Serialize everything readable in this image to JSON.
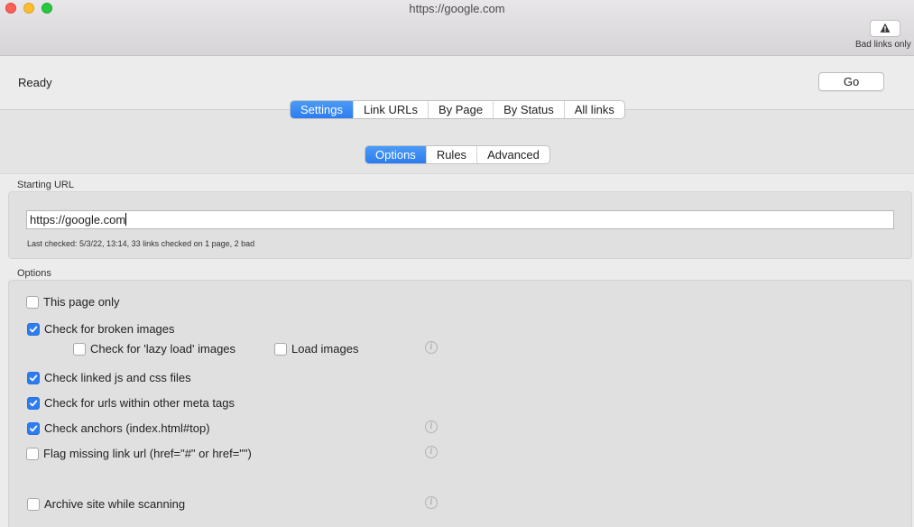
{
  "window": {
    "title": "https://google.com",
    "bad_links_label": "Bad links only"
  },
  "toolbar": {
    "status": "Ready",
    "go_label": "Go"
  },
  "main_tabs": [
    {
      "label": "Settings",
      "active": true
    },
    {
      "label": "Link URLs",
      "active": false
    },
    {
      "label": "By Page",
      "active": false
    },
    {
      "label": "By Status",
      "active": false
    },
    {
      "label": "All links",
      "active": false
    }
  ],
  "sub_tabs": [
    {
      "label": "Options",
      "active": true
    },
    {
      "label": "Rules",
      "active": false
    },
    {
      "label": "Advanced",
      "active": false
    }
  ],
  "starting_url": {
    "section_label": "Starting URL",
    "value": "https://google.com",
    "last_checked": "Last checked: 5/3/22, 13:14, 33 links checked on 1 page, 2 bad"
  },
  "options": {
    "section_label": "Options",
    "this_page_only": {
      "label": "This page only",
      "checked": false
    },
    "check_broken_images": {
      "label": "Check for broken images",
      "checked": true
    },
    "lazy_load_images": {
      "label": "Check for 'lazy load' images",
      "checked": false
    },
    "load_images": {
      "label": "Load images",
      "checked": false
    },
    "check_js_css": {
      "label": "Check linked js and css files",
      "checked": true
    },
    "check_meta_tags": {
      "label": "Check for urls within other meta tags",
      "checked": true
    },
    "check_anchors": {
      "label": "Check anchors (index.html#top)",
      "checked": true
    },
    "flag_missing_url": {
      "label": "Flag missing link url (href=\"#\" or href=\"\")",
      "checked": false
    },
    "archive_site": {
      "label": "Archive site while scanning",
      "checked": false
    }
  },
  "colors": {
    "accent": "#2d7cf0"
  }
}
